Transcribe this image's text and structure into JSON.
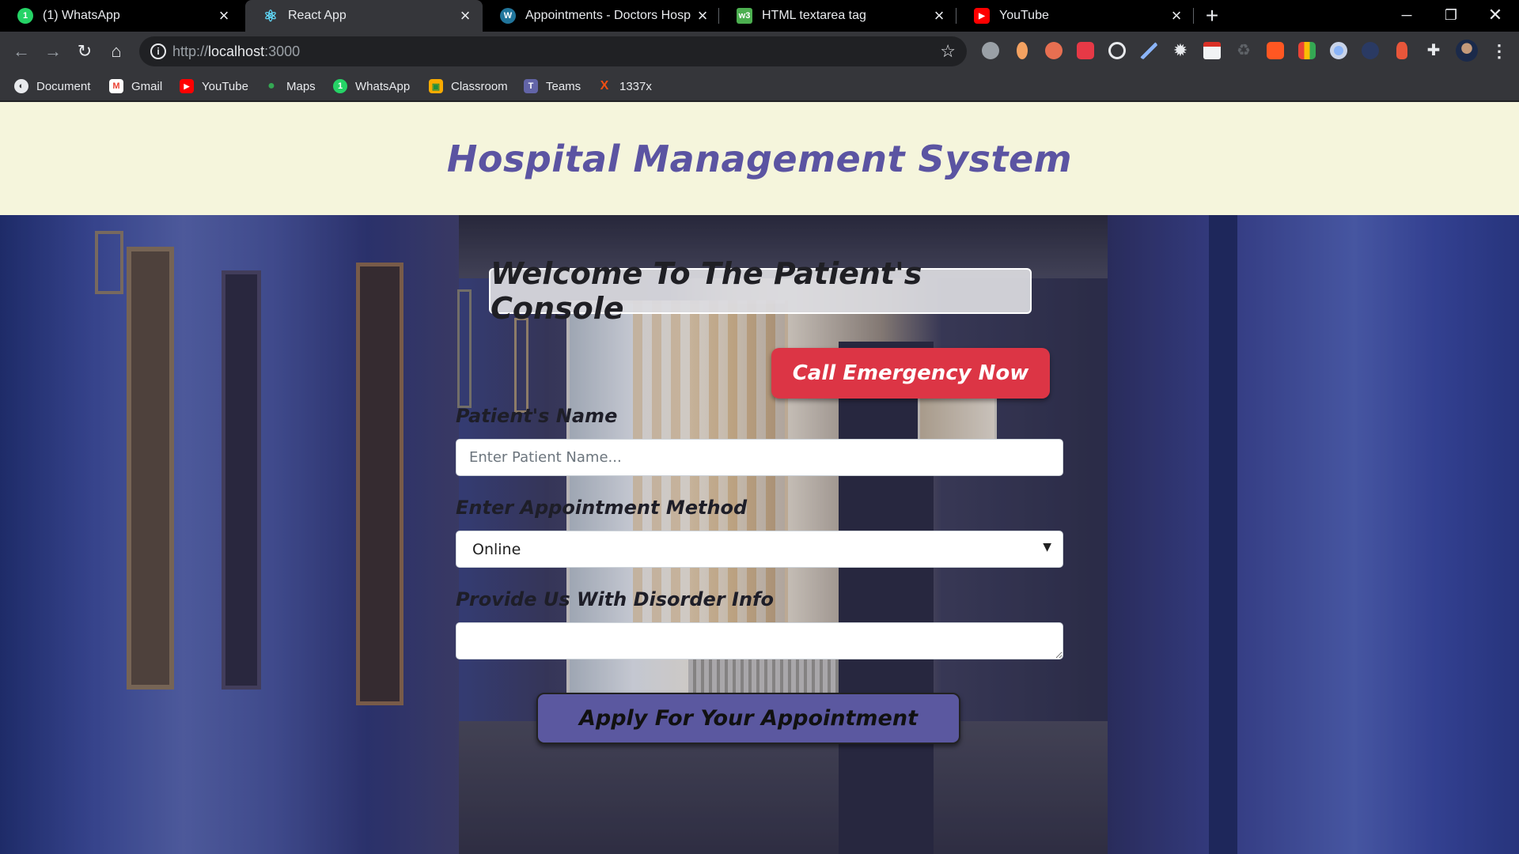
{
  "browser": {
    "tabs": [
      {
        "title": "(1) WhatsApp",
        "icon": "whatsapp-icon",
        "color": "#25d366",
        "glyph": "1"
      },
      {
        "title": "React App",
        "icon": "react-icon",
        "color": "#61dafb",
        "glyph": "⚛"
      },
      {
        "title": "Appointments - Doctors Hospital",
        "icon": "wordpress-icon",
        "color": "#21759b",
        "glyph": "W"
      },
      {
        "title": "HTML textarea tag",
        "icon": "w3schools-icon",
        "color": "#4caf50",
        "glyph": "w3"
      },
      {
        "title": "YouTube",
        "icon": "youtube-icon",
        "color": "#ff0000",
        "glyph": "▶"
      }
    ],
    "active_tab": 1,
    "address": {
      "scheme": "http://",
      "host": "localhost",
      "port": ":3000"
    },
    "bookmarks": [
      {
        "label": "Document",
        "icon": "document-icon",
        "color": "#e8eaed",
        "glyph": "◐"
      },
      {
        "label": "Gmail",
        "icon": "gmail-icon",
        "color": "#ea4335",
        "glyph": "M"
      },
      {
        "label": "YouTube",
        "icon": "youtube-icon",
        "color": "#ff0000",
        "glyph": "▶"
      },
      {
        "label": "Maps",
        "icon": "maps-icon",
        "color": "#34a853",
        "glyph": "●"
      },
      {
        "label": "WhatsApp",
        "icon": "whatsapp-icon",
        "color": "#25d366",
        "glyph": "1"
      },
      {
        "label": "Classroom",
        "icon": "classroom-icon",
        "color": "#f9ab00",
        "glyph": "▣"
      },
      {
        "label": "Teams",
        "icon": "teams-icon",
        "color": "#6264a7",
        "glyph": "T"
      },
      {
        "label": "1337x",
        "icon": "1337x-icon",
        "color": "#f14e13",
        "glyph": "X"
      }
    ]
  },
  "header": {
    "title": "Hospital Management System"
  },
  "console": {
    "welcome": "Welcome To The Patient's Console",
    "emergency_button": "Call Emergency Now",
    "patient_name_label": "Patient's Name",
    "patient_name_placeholder": "Enter Patient Name...",
    "patient_name_value": "",
    "method_label": "Enter Appointment Method",
    "method_selected": "Online",
    "disorder_label": "Provide Us With Disorder Info",
    "disorder_value": "",
    "apply_button": "Apply For Your Appointment"
  },
  "colors": {
    "header_bg": "#f5f5dc",
    "title": "#5b54a2",
    "emergency": "#dc3545",
    "apply": "#5b58a0"
  }
}
